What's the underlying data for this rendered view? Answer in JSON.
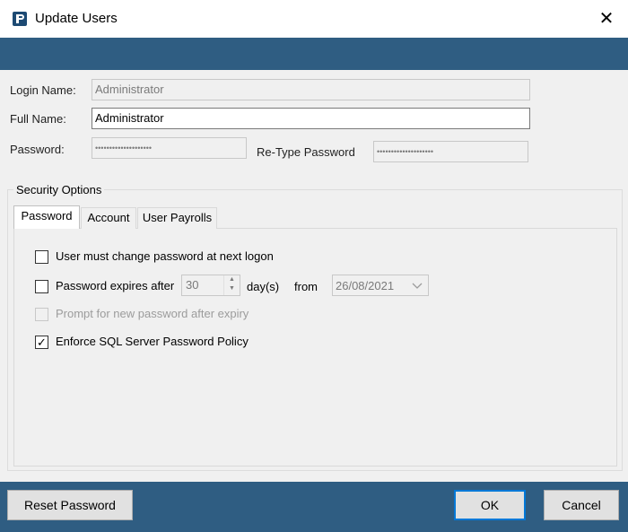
{
  "window": {
    "title": "Update Users",
    "close_symbol": "✕",
    "icon": "app-logo-icon"
  },
  "form": {
    "login_name_label": "Login Name:",
    "login_name_value": "Administrator",
    "full_name_label": "Full Name:",
    "full_name_value": "Administrator",
    "password_label": "Password:",
    "password_value": "••••••••••••••••••••",
    "retype_password_label": "Re-Type Password",
    "retype_password_value": "••••••••••••••••••••"
  },
  "security": {
    "group_label": "Security Options",
    "tabs": [
      {
        "label": "Password",
        "selected": true
      },
      {
        "label": "Account",
        "selected": false
      },
      {
        "label": "User Payrolls",
        "selected": false
      }
    ],
    "must_change_label": "User must change password at next logon",
    "must_change_checked": false,
    "expires_label": "Password expires after",
    "expires_checked": false,
    "expires_days": "30",
    "days_unit": "day(s)",
    "from_label": "from",
    "from_date": "26/08/2021",
    "prompt_label": "Prompt for new password after expiry",
    "prompt_checked": false,
    "prompt_enabled": false,
    "enforce_label": "Enforce SQL Server Password Policy",
    "enforce_checked": true,
    "check_glyph": "✓"
  },
  "buttons": {
    "reset_password": "Reset Password",
    "ok": "OK",
    "cancel": "Cancel"
  },
  "colors": {
    "accent_bar": "#2f5d82",
    "default_button_border": "#0078d7"
  }
}
